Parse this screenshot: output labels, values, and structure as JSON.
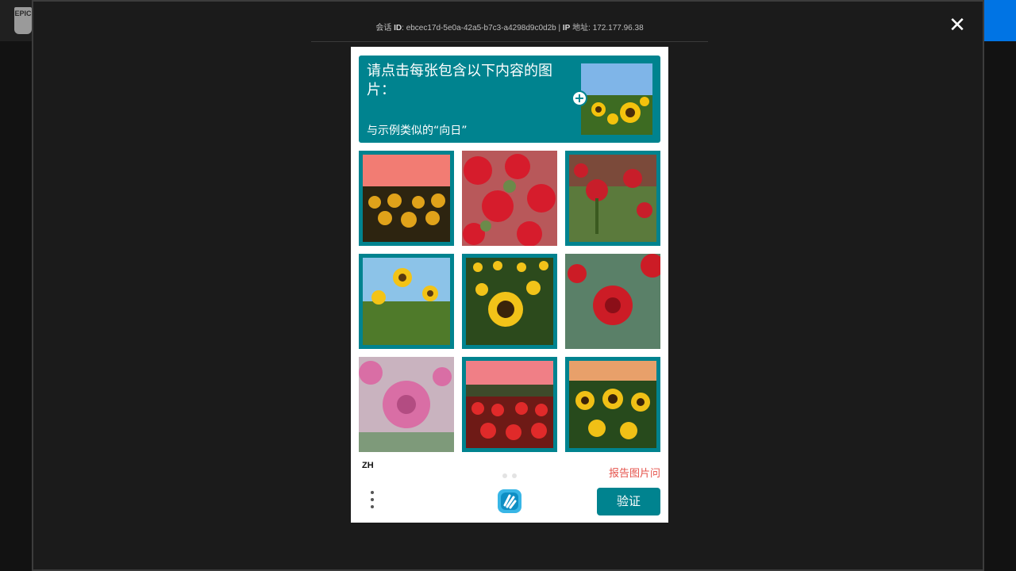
{
  "app": {
    "logo_text": "EPIC"
  },
  "session": {
    "id_label_prefix": "会话",
    "id_label": "ID",
    "id_value": "ebcec17d-5e0a-42a5-b7c3-a4298d9c0d2b",
    "ip_label": "IP",
    "ip_label_suffix": "地址",
    "ip_value": "172.177.96.38"
  },
  "captcha": {
    "prompt_title": "请点击每张包含以下内容的图片：",
    "prompt_subtitle": "与示例类似的“向日”",
    "images": [
      {
        "subject": "sunflower-field-pink-sky",
        "selected": true
      },
      {
        "subject": "red-roses",
        "selected": false
      },
      {
        "subject": "red-rose-bud",
        "selected": true
      },
      {
        "subject": "sunflowers-blue-sky",
        "selected": true
      },
      {
        "subject": "sunflower-field",
        "selected": true
      },
      {
        "subject": "red-rose",
        "selected": false
      },
      {
        "subject": "pink-rose",
        "selected": false
      },
      {
        "subject": "red-flower-field-sunset",
        "selected": true
      },
      {
        "subject": "sunflowers-sunset",
        "selected": true
      }
    ],
    "language": "ZH",
    "report_label": "报告图片问",
    "submit_label": "验证",
    "accent_color": "#00838f"
  },
  "icons": {
    "close": "close-icon",
    "menu": "more-vertical-icon",
    "plus": "plus-icon",
    "brand": "hcaptcha-hand-icon"
  }
}
